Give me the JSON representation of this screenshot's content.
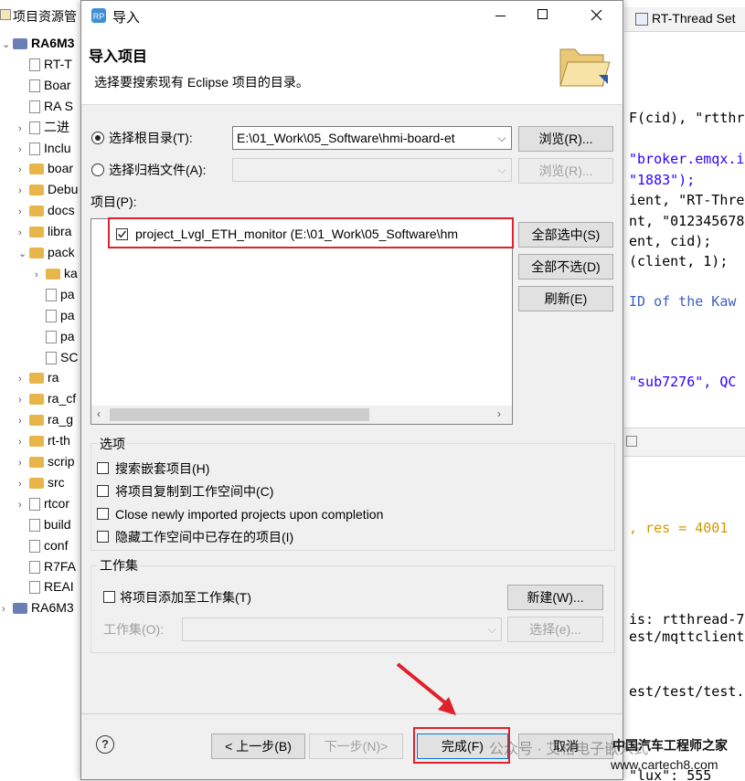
{
  "background_left": {
    "tab_title": "项目资源管",
    "rows": [
      {
        "label": "RA6M3",
        "bold": true,
        "icon": "project-icon",
        "twisty": "⌄",
        "indent": 0
      },
      {
        "label": "RT-T",
        "icon": "rt-thread-icon",
        "twisty": "",
        "indent": 1
      },
      {
        "label": "Boar",
        "icon": "board-icon",
        "twisty": "",
        "indent": 1
      },
      {
        "label": "RA S",
        "icon": "ra-smart-icon",
        "twisty": "",
        "indent": 1
      },
      {
        "label": "二进",
        "icon": "binary-icon",
        "twisty": "›",
        "indent": 1
      },
      {
        "label": "Inclu",
        "icon": "includes-icon",
        "twisty": "›",
        "indent": 1
      },
      {
        "label": "boar",
        "icon": "folder-icon",
        "twisty": "›",
        "indent": 1
      },
      {
        "label": "Debu",
        "icon": "folder-icon",
        "twisty": "›",
        "indent": 1
      },
      {
        "label": "docs",
        "icon": "folder-icon",
        "twisty": "›",
        "indent": 1
      },
      {
        "label": "libra",
        "icon": "folder-icon",
        "twisty": "›",
        "indent": 1
      },
      {
        "label": "pack",
        "icon": "folder-icon",
        "twisty": "⌄",
        "indent": 1
      },
      {
        "label": "ka",
        "icon": "folder-icon",
        "twisty": "›",
        "indent": 2
      },
      {
        "label": "pa",
        "icon": "file-icon",
        "twisty": "",
        "indent": 2
      },
      {
        "label": "pa",
        "icon": "file-icon",
        "twisty": "",
        "indent": 2
      },
      {
        "label": "pa",
        "icon": "file-icon",
        "twisty": "",
        "indent": 2
      },
      {
        "label": "SC",
        "icon": "file-icon",
        "twisty": "",
        "indent": 2
      },
      {
        "label": "ra",
        "icon": "folder-icon",
        "twisty": "›",
        "indent": 1
      },
      {
        "label": "ra_cf",
        "icon": "folder-icon",
        "twisty": "›",
        "indent": 1
      },
      {
        "label": "ra_g",
        "icon": "folder-icon",
        "twisty": "›",
        "indent": 1
      },
      {
        "label": "rt-th",
        "icon": "folder-icon",
        "twisty": "›",
        "indent": 1
      },
      {
        "label": "scrip",
        "icon": "folder-icon",
        "twisty": "›",
        "indent": 1
      },
      {
        "label": "src",
        "icon": "folder-icon",
        "twisty": "›",
        "indent": 1
      },
      {
        "label": "rtcor",
        "icon": "header-file-icon",
        "twisty": "›",
        "indent": 1
      },
      {
        "label": "build",
        "icon": "file-icon",
        "twisty": "",
        "indent": 1
      },
      {
        "label": "conf",
        "icon": "file-icon",
        "twisty": "",
        "indent": 1
      },
      {
        "label": "R7FA",
        "icon": "file-icon",
        "twisty": "",
        "indent": 1
      },
      {
        "label": "REAI",
        "icon": "file-icon",
        "twisty": "",
        "indent": 1
      },
      {
        "label": "RA6M3",
        "icon": "project-icon",
        "twisty": "›",
        "indent": 0
      }
    ]
  },
  "background_right": {
    "tab_title": "RT-Thread Set",
    "code_lines": [
      {
        "text": "F(cid), \"rtthr",
        "style": "mixed"
      },
      {
        "text": "\"broker.emqx.i",
        "style": "str"
      },
      {
        "text": "\"1883\");",
        "style": "str"
      },
      {
        "text": "ient, \"RT-Threa",
        "style": "mixed"
      },
      {
        "text": "nt, \"012345678",
        "style": "mixed"
      },
      {
        "text": "ent, cid);",
        "style": "plain"
      },
      {
        "text": "(client, 1);",
        "style": "plain"
      },
      {
        "text": "ID of the Kaw",
        "style": "cmt"
      },
      {
        "text": "\"sub7276\", QC",
        "style": "str"
      },
      {
        "text": ", res = 4001",
        "style": "warn"
      },
      {
        "text": "is: rtthread-7",
        "style": "plain"
      },
      {
        "text": "est/mqttclient/",
        "style": "plain"
      },
      {
        "text": "est/test/test.c",
        "style": "plain"
      },
      {
        "text": "\"lux\": 555",
        "style": "plain"
      }
    ]
  },
  "dialog": {
    "title": "导入",
    "header_title": "导入项目",
    "header_desc": "选择要搜索现有 Eclipse 项目的目录。",
    "radio_root_label": "选择根目录(T):",
    "root_dir_value": "E:\\01_Work\\05_Software\\hmi-board-et",
    "browse_label": "浏览(R)...",
    "radio_archive_label": "选择归档文件(A):",
    "archive_value": "",
    "browse2_label": "浏览(R)...",
    "projects_label": "项目(P):",
    "project_item": "project_Lvgl_ETH_monitor  (E:\\01_Work\\05_Software\\hm",
    "select_all_label": "全部选中(S)",
    "deselect_all_label": "全部不选(D)",
    "refresh_label": "刷新(E)",
    "options_label": "选项",
    "options": [
      {
        "label": "搜索嵌套项目(H)",
        "checked": false
      },
      {
        "label": "将项目复制到工作空间中(C)",
        "checked": false
      },
      {
        "label": "Close newly imported projects upon completion",
        "checked": false
      },
      {
        "label": "隐藏工作空间中已存在的项目(I)",
        "checked": false
      }
    ],
    "workset_group_label": "工作集",
    "workset_add_label": "将项目添加至工作集(T)",
    "new_label": "新建(W)...",
    "workset_field_label": "工作集(O):",
    "select_label": "选择(e)...",
    "help_symbol": "?",
    "back_label": "< 上一步(B)",
    "next_label": "下一步(N)>",
    "finish_label": "完成(F)",
    "cancel_label": "取消"
  },
  "watermark": {
    "text1": "公众号 · 艾格电子嵌入式",
    "text2": "中国汽车工程师之家",
    "text3": "www.cartech8.com"
  }
}
